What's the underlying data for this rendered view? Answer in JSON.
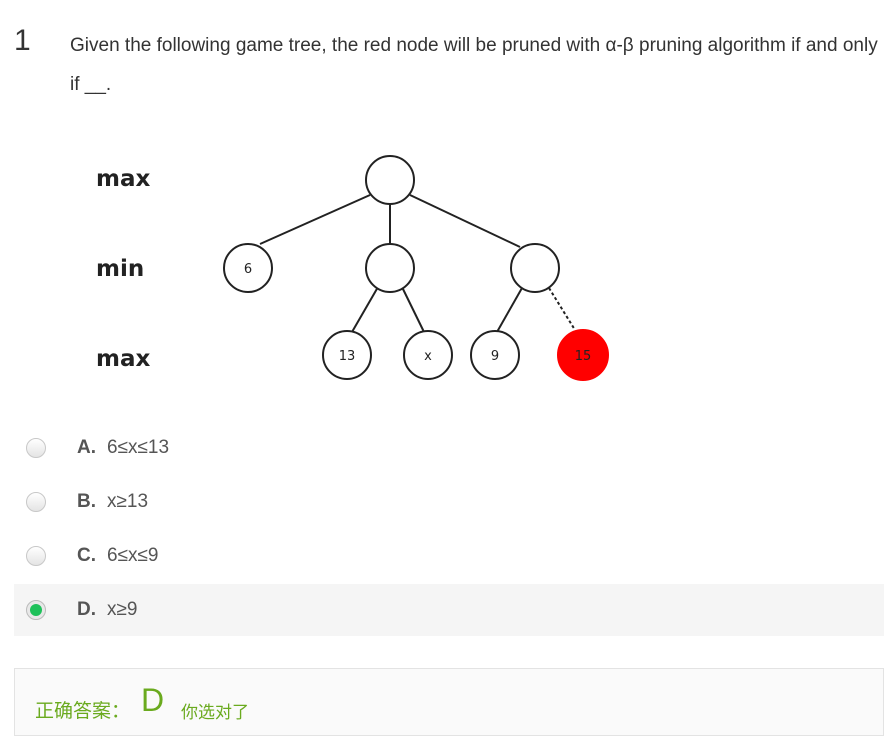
{
  "question": {
    "number": "1",
    "text": "Given the following game tree, the red node will be pruned with α-β pruning algorithm if and only if __."
  },
  "tree": {
    "levels": [
      "max",
      "min",
      "max"
    ],
    "nodes": {
      "root": "",
      "min_left": "6",
      "min_middle": "",
      "min_right": "",
      "leaf_1": "13",
      "leaf_2": "x",
      "leaf_3": "9",
      "leaf_4": "15"
    },
    "pruned_node_color": "#ff0000"
  },
  "options": [
    {
      "letter": "A.",
      "text": "6≤x≤13",
      "selected": false
    },
    {
      "letter": "B.",
      "text": "x≥13",
      "selected": false
    },
    {
      "letter": "C.",
      "text": "6≤x≤9",
      "selected": false
    },
    {
      "letter": "D.",
      "text": "x≥9",
      "selected": true
    }
  ],
  "answer": {
    "label": "正确答案：",
    "letter": "D",
    "message": "你选对了"
  },
  "colors": {
    "correct_green": "#6aaa1e",
    "radio_selected": "#1ec15a"
  }
}
